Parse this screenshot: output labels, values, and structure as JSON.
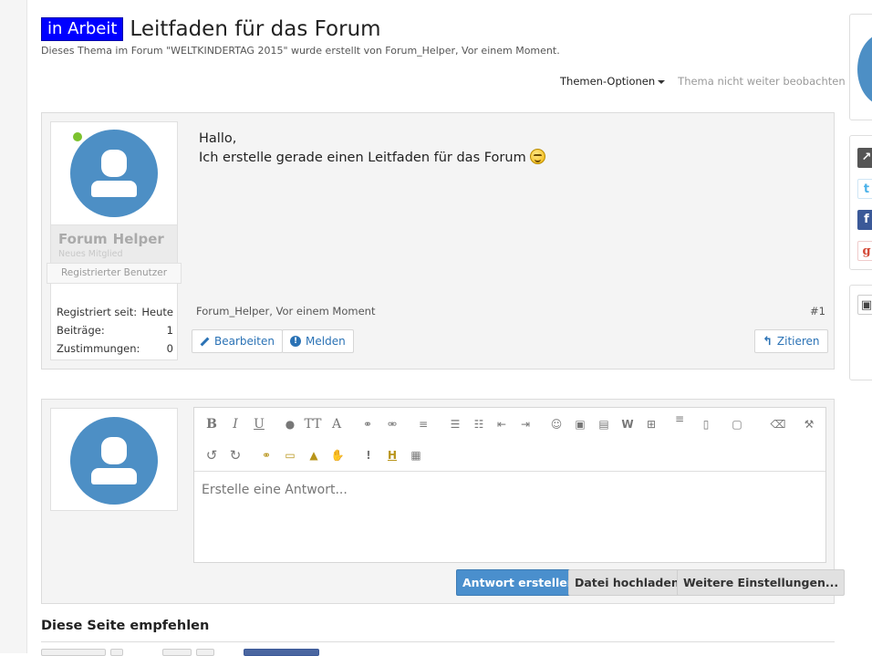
{
  "thread": {
    "prefix": "in Arbeit",
    "title": "Leitfaden für das Forum",
    "subtitle": "Dieses Thema im Forum \"WELTKINDERTAG 2015\" wurde erstellt von Forum_Helper, Vor einem Moment."
  },
  "thread_tools": {
    "options_label": "Themen-Optionen",
    "unwatch_label": "Thema nicht weiter beobachten"
  },
  "post": {
    "author": {
      "name": "Forum_Helper",
      "title": "Neues Mitglied",
      "rank": "Registrierter Benutzer",
      "online": true
    },
    "stats": [
      {
        "label": "Registriert seit:",
        "value": "Heute"
      },
      {
        "label": "Beiträge:",
        "value": "1"
      },
      {
        "label": "Zustimmungen:",
        "value": "0"
      }
    ],
    "message_line1": "Hallo,",
    "message_line2": "Ich erstelle gerade einen Leitfaden für das Forum",
    "smiley": "grin-smiley-icon",
    "meta": "Forum_Helper, Vor einem Moment",
    "number": "#1",
    "edit_label": "Bearbeiten",
    "report_label": "Melden",
    "quote_label": "Zitieren"
  },
  "reply": {
    "placeholder": "Erstelle eine Antwort...",
    "submit_label": "Antwort erstellen",
    "upload_label": "Datei hochladen",
    "more_label": "Weitere Einstellungen..."
  },
  "toolbar_row1": [
    "bold-icon",
    "italic-icon",
    "underline-icon",
    "text-color-icon",
    "font-size-icon",
    "font-family-icon",
    "link-icon",
    "unlink-icon",
    "align-icon",
    "bullet-list-icon",
    "numbered-list-icon",
    "outdent-icon",
    "indent-icon",
    "smilies-icon",
    "image-icon",
    "media-icon",
    "wikipedia-icon",
    "insert-icon",
    "drafts-icon",
    "template-icon",
    "save-draft-icon",
    "remove-format-icon",
    "settings-icon"
  ],
  "toolbar_row2": [
    "undo-icon",
    "redo-icon",
    "bbcode-link-icon",
    "bbcode-box-icon",
    "bbcode-triangle-icon",
    "bbcode-hand-icon",
    "exclamation-icon",
    "heading-icon",
    "table-icon"
  ],
  "share": {
    "title": "Diese Seite empfehlen"
  },
  "colors": {
    "prefix_bg": "#0000ff",
    "accent": "#4a8fcd",
    "online": "#7cc22e",
    "link": "#2a72b5"
  }
}
